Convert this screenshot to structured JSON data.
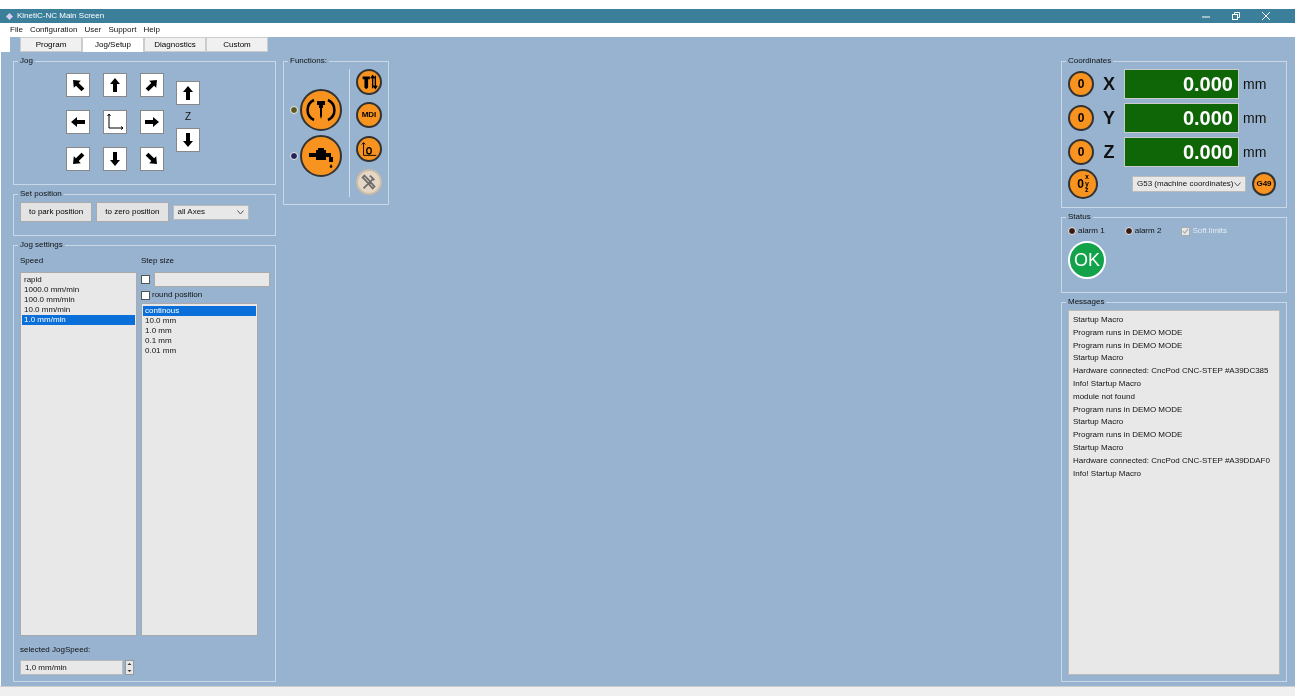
{
  "window": {
    "title": "KinetiC-NC Main Screen"
  },
  "menu": [
    "File",
    "Configuration",
    "User",
    "Support",
    "Help"
  ],
  "tabs": [
    {
      "label": "Program",
      "selected": false
    },
    {
      "label": "Jog/Setup",
      "selected": true
    },
    {
      "label": "Diagnostics",
      "selected": false
    },
    {
      "label": "Custom",
      "selected": false
    }
  ],
  "jog": {
    "title": "Jog",
    "buttons": [
      {
        "kind": "nw"
      },
      {
        "kind": "n"
      },
      {
        "kind": "ne"
      },
      {
        "kind": "w"
      },
      {
        "kind": "axes"
      },
      {
        "kind": "e"
      },
      {
        "kind": "sw"
      },
      {
        "kind": "s"
      },
      {
        "kind": "se"
      }
    ],
    "z_label": "Z",
    "z_buttons": [
      {
        "kind": "n"
      },
      {
        "kind": "s"
      }
    ]
  },
  "set_position": {
    "title": "Set position",
    "buttons": [
      "to park position",
      "to zero position"
    ],
    "axes_select": "all Axes"
  },
  "jog_settings": {
    "title": "Jog settings",
    "speed_label": "Speed",
    "speeds": [
      {
        "label": "rapid",
        "selected": false
      },
      {
        "label": "1000.0 mm/min",
        "selected": false
      },
      {
        "label": "100.0 mm/min",
        "selected": false
      },
      {
        "label": "10.0 mm/min",
        "selected": false
      },
      {
        "label": "1.0 mm/min",
        "selected": true
      }
    ],
    "step_label": "Step size",
    "step_custom_checked": false,
    "round_position": {
      "label": "round position",
      "checked": false
    },
    "steps": [
      {
        "label": "continous",
        "selected": true
      },
      {
        "label": "10.0 mm",
        "selected": false
      },
      {
        "label": "1.0 mm",
        "selected": false
      },
      {
        "label": "0.1 mm",
        "selected": false
      },
      {
        "label": "0.01 mm",
        "selected": false
      }
    ],
    "selected_speed_label": "selected JogSpeed:",
    "selected_speed_value": "1,0 mm/min"
  },
  "functions": {
    "title": "Functions:",
    "main_buttons": [
      {
        "kind": "spindle",
        "color": "#5a5a1e"
      },
      {
        "kind": "coolant",
        "color": "#23235a"
      }
    ],
    "side_buttons": [
      {
        "kind": "tool-change",
        "disabled": false
      },
      {
        "kind": "mdi",
        "label": "MDI",
        "disabled": false
      },
      {
        "kind": "zero-set",
        "disabled": false
      },
      {
        "kind": "tools",
        "disabled": true
      }
    ]
  },
  "coordinates": {
    "title": "Coordinates",
    "axes": [
      {
        "zero": "0",
        "axis": "X",
        "value": "0.000",
        "unit": "mm"
      },
      {
        "zero": "0",
        "axis": "Y",
        "value": "0.000",
        "unit": "mm"
      },
      {
        "zero": "0",
        "axis": "Z",
        "value": "0.000",
        "unit": "mm"
      }
    ],
    "zero_all": {
      "label": "0",
      "sub": [
        "x",
        "y",
        "z"
      ]
    },
    "system_select": "G53 (machine coordinates)",
    "g49_button": "G49"
  },
  "status": {
    "title": "Status",
    "alarms": [
      {
        "label": "alarm 1",
        "on": false
      },
      {
        "label": "alarm 2",
        "on": false
      }
    ],
    "soft_limits": {
      "label": "Soft limits",
      "checked": true,
      "disabled": true
    },
    "ok": "OK"
  },
  "messages": {
    "title": "Messages",
    "items": [
      "Startup Macro",
      "Program runs in DEMO MODE",
      "Program runs in DEMO MODE",
      "Startup Macro",
      "Hardware connected: CncPod CNC-STEP #A39DC385",
      "Info! Startup Macro",
      "module not found",
      "Program runs in DEMO MODE",
      "Startup Macro",
      "Program runs in DEMO MODE",
      "Startup Macro",
      "Hardware connected: CncPod CNC-STEP #A39DDAF0",
      "Info! Startup Macro"
    ]
  }
}
